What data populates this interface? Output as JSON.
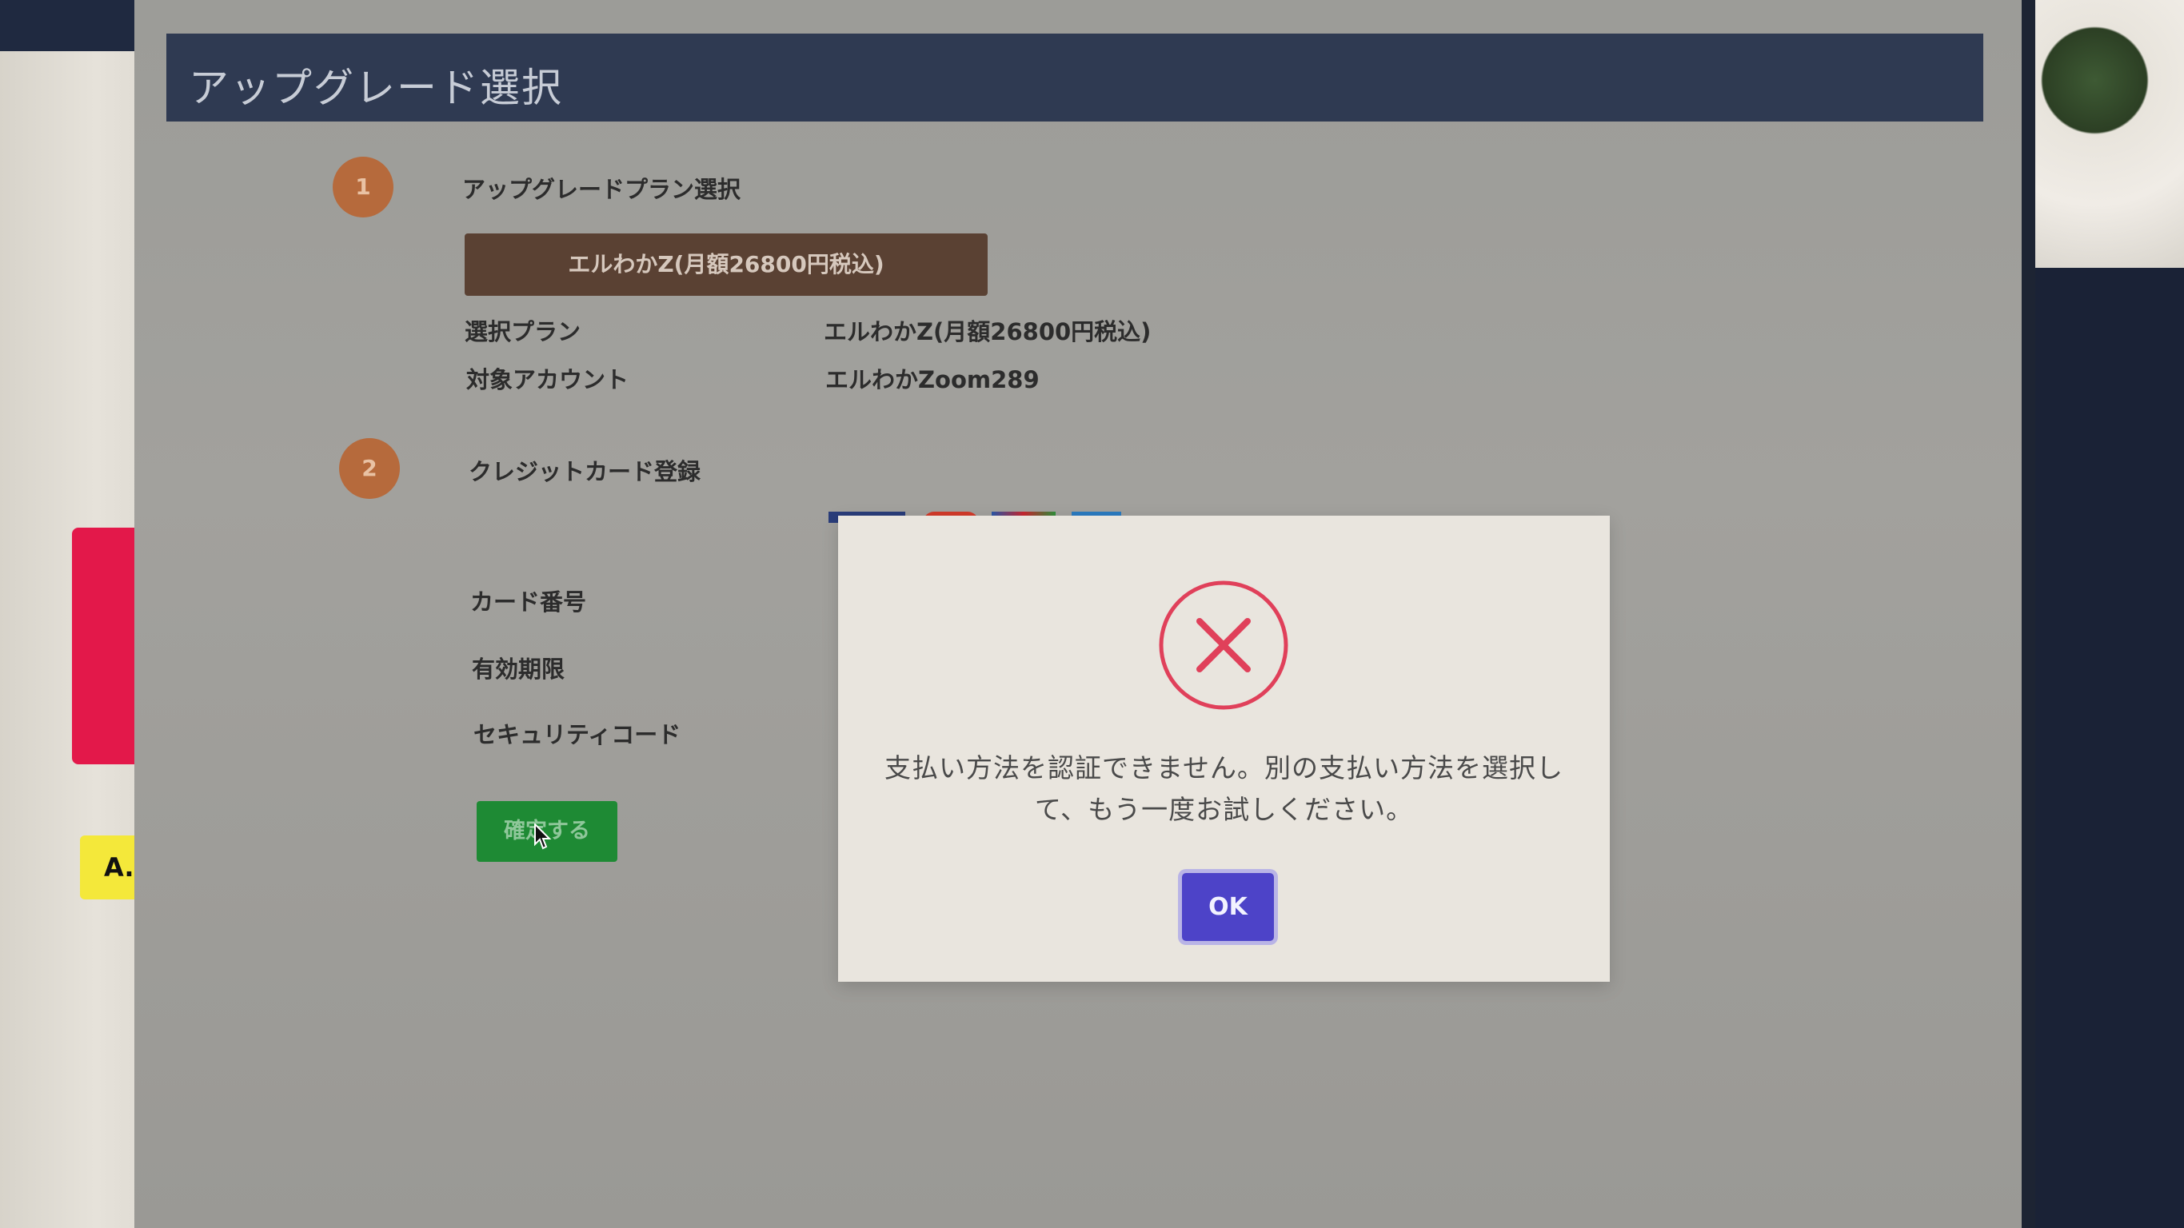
{
  "header": {
    "title": "アップグレード選択"
  },
  "step1": {
    "number": "1",
    "title": "アップグレードプラン選択",
    "plan_button_label": "エルわかZ(月額26800円税込)",
    "selected_plan_label": "選択プラン",
    "selected_plan_value": "エルわかZ(月額26800円税込)",
    "target_account_label": "対象アカウント",
    "target_account_value": "エルわかZoom289"
  },
  "step2": {
    "number": "2",
    "title": "クレジットカード登録",
    "card_number_label": "カード番号",
    "expiry_label": "有効期限",
    "security_code_label": "セキュリティコード",
    "confirm_button_label": "確定する"
  },
  "side_note": {
    "text": "A. エ"
  },
  "modal": {
    "icon": "error-x-circle-icon",
    "message_line1": "支払い方法を認証できません。別の支払い方法を選択し",
    "message_line2": "て、もう一度お試しください。",
    "ok_label": "OK"
  },
  "colors": {
    "header_bg": "#2f3a52",
    "step_circle": "#b66a3c",
    "plan_button": "#5a4133",
    "confirm_button": "#1e8a34",
    "error_red": "#e0405a",
    "ok_button": "#4d43c8"
  }
}
